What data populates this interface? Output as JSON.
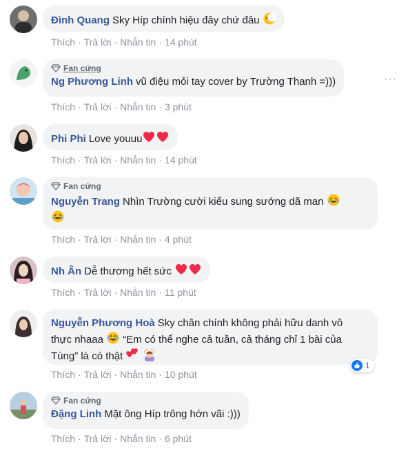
{
  "comments": [
    {
      "author": "Đình Quang",
      "text": "Sky Híp chính hiệu đây chứ đâu",
      "emojis": [
        "moon-face"
      ],
      "badge": "",
      "time": "14 phút"
    },
    {
      "author": "Ng Phương Linh",
      "text": "vũ điệu mỏi tay cover by Trường Thanh =)))",
      "emojis": [],
      "badge": "Fan cứng",
      "time": "3 phút"
    },
    {
      "author": "Phi Phi",
      "text": "Love youuu",
      "emojis": [
        "heart",
        "heart"
      ],
      "badge": "",
      "time": "14 phút"
    },
    {
      "author": "Nguyễn Trang",
      "text": "Nhìn Trường cười kiểu sung sướng dã man",
      "emojis": [
        "rofl",
        "rofl"
      ],
      "badge": "Fan cứng",
      "time": "4 phút"
    },
    {
      "author": "Nh Ân",
      "text": "Dễ thương hết sức",
      "emojis": [
        "heart",
        "heart"
      ],
      "badge": "",
      "time": "11 phút"
    },
    {
      "author": "Nguyễn Phương Hoà",
      "text_line1": "Sky chân chính không phải hữu danh vô",
      "text_line2": "thực nhaaa",
      "text_line2b": "“Em có thể nghe cả tuần, cả tháng chỉ 1 bài của",
      "text_line3": "Tùng” là có thật",
      "emojis": [
        "tears-of-joy",
        "two-hearts",
        "person-gesturing-ok"
      ],
      "badge": "",
      "time": "10 phút",
      "reaction_count": "1",
      "reaction_icon": "like-icon"
    },
    {
      "author": "Đặng Linh",
      "text": "Mặt ông Híp trông hớn vãi :)))",
      "emojis": [],
      "badge": "Fan cứng",
      "time": "6 phút"
    }
  ],
  "actions": {
    "like": "Thích",
    "reply": "Trả lời",
    "message": "Nhắn tin",
    "separator": "·"
  },
  "colors": {
    "author": "#385898",
    "bubble": "#f2f3f5",
    "meta": "#8d949e",
    "heart": "#f02849",
    "like_blue": "#1877f2"
  },
  "more_menu": "···"
}
